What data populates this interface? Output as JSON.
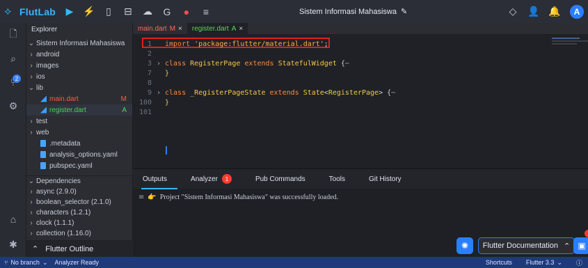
{
  "app": {
    "brand_name": "FlutLab",
    "project_title": "Sistem Informasi Mahasiswa",
    "avatar_initial": "A"
  },
  "explorer": {
    "header": "Explorer",
    "root": "Sistem Informasi Mahasiswa",
    "items": [
      {
        "chev": "›",
        "label": "android"
      },
      {
        "chev": "›",
        "label": "images"
      },
      {
        "chev": "›",
        "label": "ios"
      },
      {
        "chev": "⌄",
        "label": "lib"
      },
      {
        "label": "main.dart",
        "status": "M"
      },
      {
        "label": "register.dart",
        "status": "A"
      },
      {
        "chev": "›",
        "label": "test"
      },
      {
        "chev": "›",
        "label": "web"
      },
      {
        "label": ".metadata"
      },
      {
        "label": "analysis_options.yaml"
      },
      {
        "label": "pubspec.yaml"
      }
    ]
  },
  "dependencies": {
    "header": "Dependencies",
    "items": [
      "async (2.9.0)",
      "boolean_selector (2.1.0)",
      "characters (1.2.1)",
      "clock (1.1.1)",
      "collection (1.16.0)"
    ]
  },
  "outline": {
    "label": "Flutter Outline"
  },
  "tabs": [
    {
      "label": "main.dart",
      "status": "M"
    },
    {
      "label": "register.dart",
      "status": "A"
    }
  ],
  "code": {
    "lines": [
      {
        "n": "1",
        "parts": [
          {
            "t": "import ",
            "c": "kw"
          },
          {
            "t": "'package:flutter/material.dart'",
            "c": "str"
          },
          {
            "t": ";",
            "c": "txt"
          }
        ]
      },
      {
        "n": "2",
        "parts": []
      },
      {
        "n": "3",
        "fold": "›",
        "parts": [
          {
            "t": "class ",
            "c": "kw"
          },
          {
            "t": "RegisterPage ",
            "c": "ty"
          },
          {
            "t": "extends ",
            "c": "kw"
          },
          {
            "t": "StatefulWidget ",
            "c": "ty"
          },
          {
            "t": "{",
            "c": "txt"
          },
          {
            "t": "⋯",
            "c": "dots"
          }
        ]
      },
      {
        "n": "7",
        "parts": [
          {
            "t": "}",
            "c": "ty"
          }
        ]
      },
      {
        "n": "8",
        "parts": []
      },
      {
        "n": "9",
        "fold": "›",
        "parts": [
          {
            "t": "class ",
            "c": "kw"
          },
          {
            "t": "_RegisterPageState ",
            "c": "ty"
          },
          {
            "t": "extends ",
            "c": "kw"
          },
          {
            "t": "State",
            "c": "ty"
          },
          {
            "t": "<",
            "c": "txt"
          },
          {
            "t": "RegisterPage",
            "c": "ty"
          },
          {
            "t": "> ",
            "c": "txt"
          },
          {
            "t": "{",
            "c": "txt"
          },
          {
            "t": "⋯",
            "c": "dots"
          }
        ]
      },
      {
        "n": "100",
        "parts": [
          {
            "t": "}",
            "c": "ty"
          }
        ]
      },
      {
        "n": "101",
        "parts": []
      }
    ]
  },
  "panel": {
    "tabs": [
      {
        "label": "Outputs"
      },
      {
        "label": "Analyzer",
        "badge": "1"
      },
      {
        "label": "Pub Commands"
      },
      {
        "label": "Tools"
      },
      {
        "label": "Git History"
      }
    ],
    "output_message": "Project \"Sistem Informasi Mahasiswa\" was successfully loaded."
  },
  "floating": {
    "flutter_doc_label": "Flutter Documentation"
  },
  "statusbar": {
    "branch": "No branch",
    "analyzer": "Analyzer Ready",
    "shortcuts": "Shortcuts",
    "flutter_version": "Flutter 3.3"
  },
  "colors": {
    "accent": "#39b6ff",
    "highlight_box": "#e0201b",
    "status_bar": "#1f3a78"
  }
}
